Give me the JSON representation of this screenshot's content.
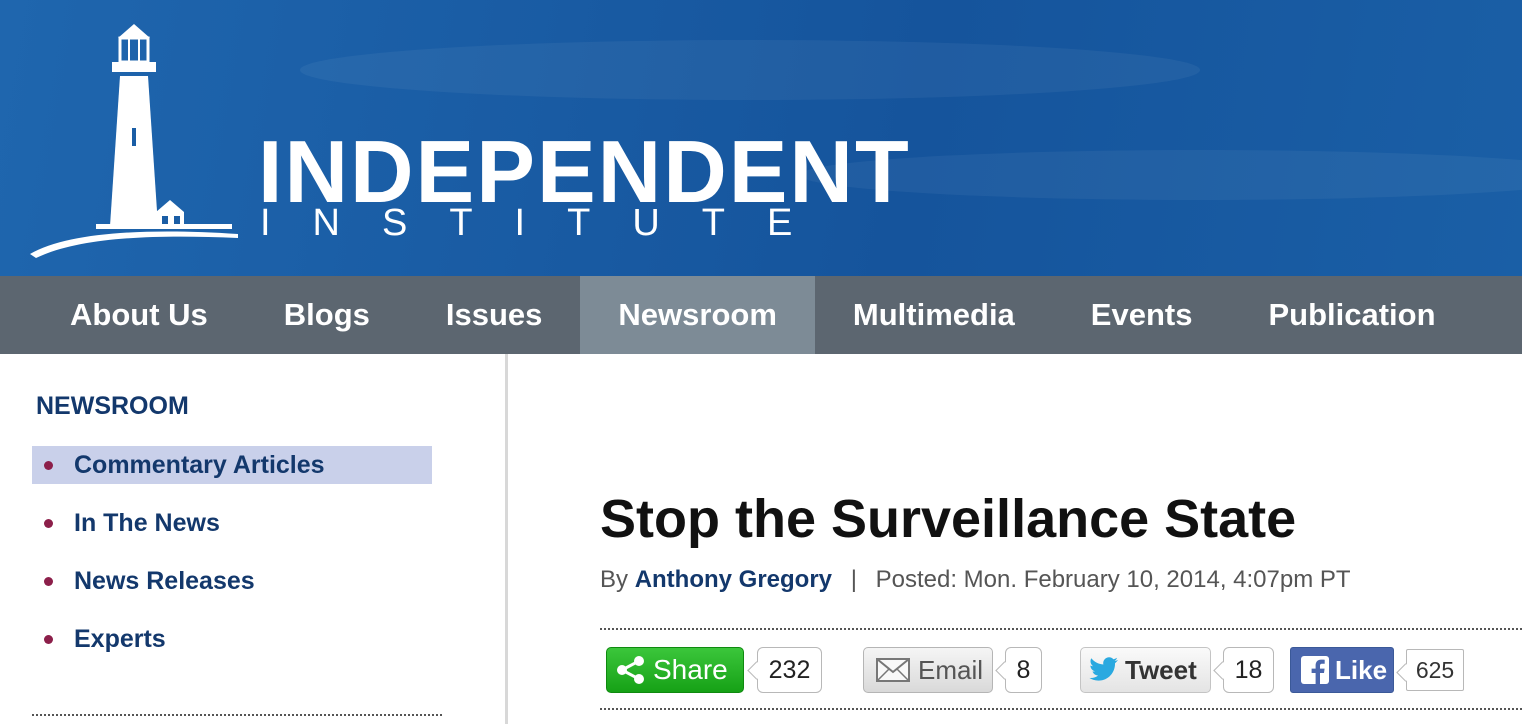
{
  "header": {
    "brand_main": "INDEPENDENT",
    "brand_sub": "INSTITUTE",
    "logo_icon": "lighthouse-icon"
  },
  "nav": {
    "items": [
      {
        "label": "About Us",
        "active": false
      },
      {
        "label": "Blogs",
        "active": false
      },
      {
        "label": "Issues",
        "active": false
      },
      {
        "label": "Newsroom",
        "active": true
      },
      {
        "label": "Multimedia",
        "active": false
      },
      {
        "label": "Events",
        "active": false
      },
      {
        "label": "Publication",
        "active": false
      }
    ]
  },
  "sidebar": {
    "title": "NEWSROOM",
    "items": [
      {
        "label": "Commentary Articles",
        "active": true
      },
      {
        "label": "In The News",
        "active": false
      },
      {
        "label": "News Releases",
        "active": false
      },
      {
        "label": "Experts",
        "active": false
      }
    ]
  },
  "article": {
    "title": "Stop the Surveillance State",
    "by_prefix": "By",
    "author": "Anthony Gregory",
    "separator": "|",
    "posted": "Posted: Mon. February 10, 2014, 4:07pm PT"
  },
  "social": {
    "share": {
      "label": "Share",
      "count": "232",
      "icon": "share-icon"
    },
    "email": {
      "label": "Email",
      "count": "8",
      "icon": "envelope-icon"
    },
    "tweet": {
      "label": "Tweet",
      "count": "18",
      "icon": "twitter-bird-icon"
    },
    "like": {
      "label": "Like",
      "count": "625",
      "icon": "facebook-icon"
    }
  },
  "colors": {
    "header_blue": "#1a5da5",
    "nav_gray": "#5c6670",
    "nav_active": "#7d8b96",
    "link_navy": "#13386c",
    "bullet": "#8c1f4a",
    "sidebar_active_bg": "#c9d0ea"
  }
}
